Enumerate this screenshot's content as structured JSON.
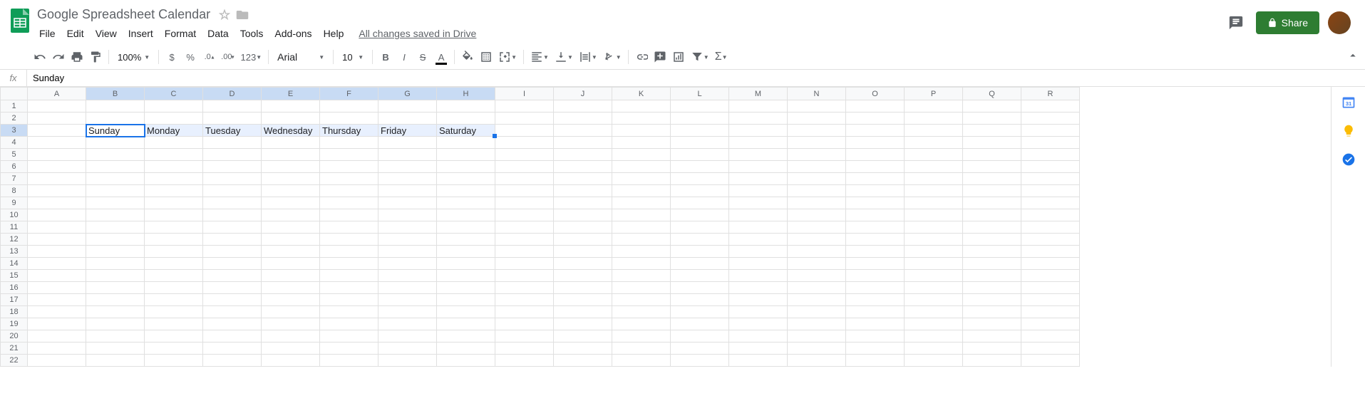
{
  "header": {
    "doc_title": "Google Spreadsheet Calendar",
    "menus": [
      "File",
      "Edit",
      "View",
      "Insert",
      "Format",
      "Data",
      "Tools",
      "Add-ons",
      "Help"
    ],
    "save_status": "All changes saved in Drive",
    "share_label": "Share"
  },
  "toolbar": {
    "zoom": "100%",
    "currency": "$",
    "percent": "%",
    "dec_less": ".0",
    "dec_more": ".00",
    "num_format": "123",
    "font": "Arial",
    "font_size": "10"
  },
  "formula_bar": {
    "fx_label": "fx",
    "value": "Sunday"
  },
  "grid": {
    "columns": [
      "A",
      "B",
      "C",
      "D",
      "E",
      "F",
      "G",
      "H",
      "I",
      "J",
      "K",
      "L",
      "M",
      "N",
      "O",
      "P",
      "Q",
      "R"
    ],
    "rows": 22,
    "selected_cols": [
      "B",
      "C",
      "D",
      "E",
      "F",
      "G",
      "H"
    ],
    "selected_row": 3,
    "active_cell": "B3",
    "cells": {
      "B3": "Sunday",
      "C3": "Monday",
      "D3": "Tuesday",
      "E3": "Wednesday",
      "F3": "Thursday",
      "G3": "Friday",
      "H3": "Saturday"
    }
  }
}
